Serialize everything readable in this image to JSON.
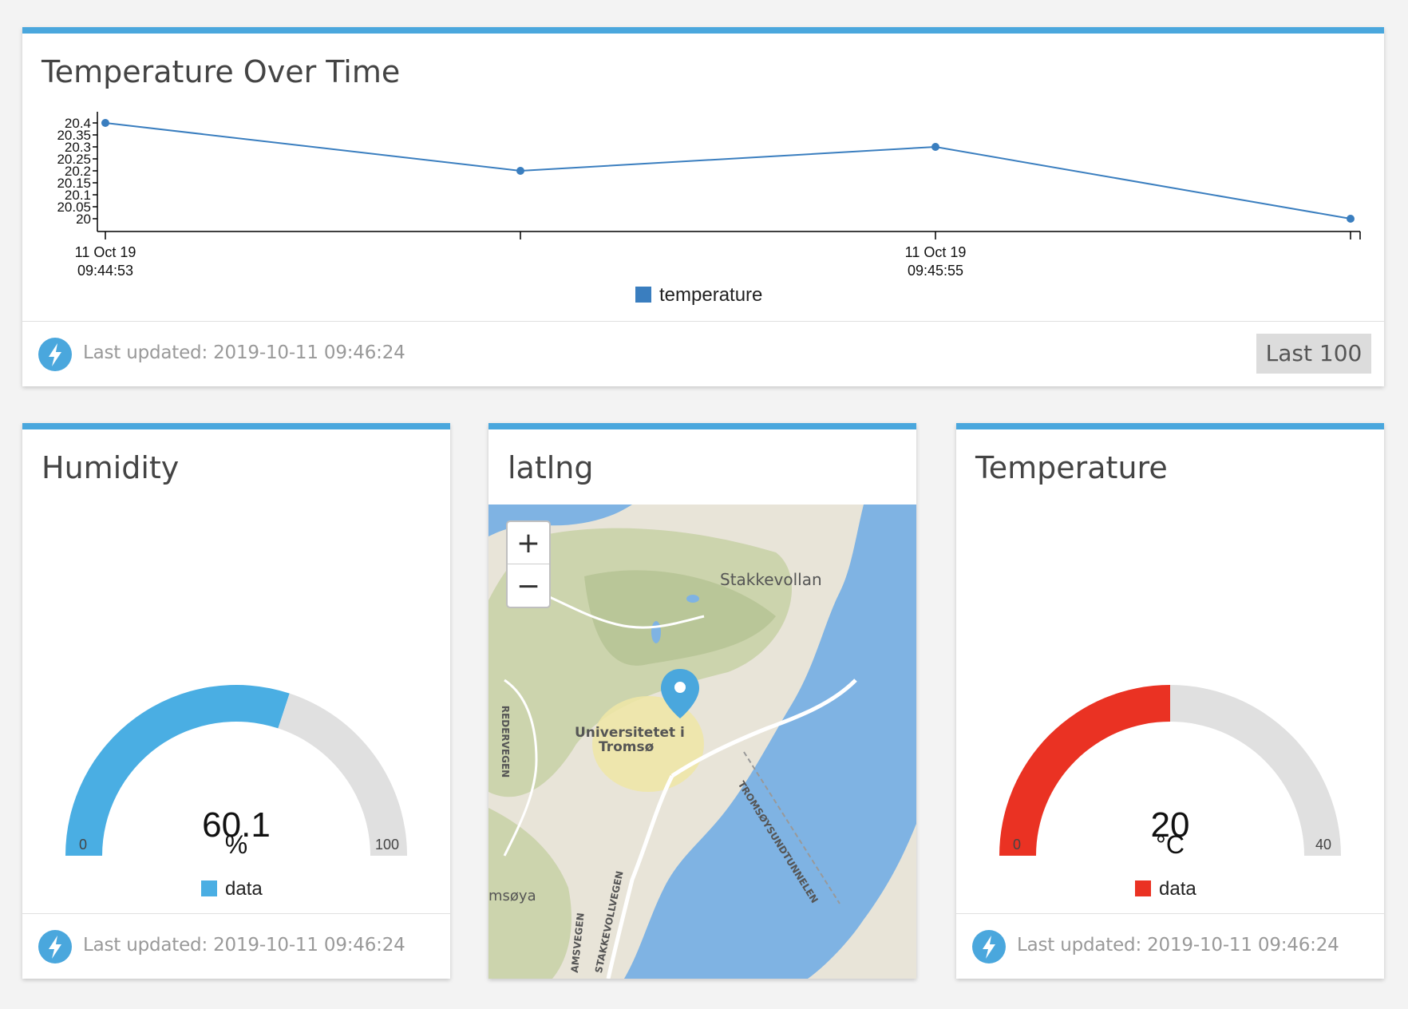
{
  "temperature_chart_card": {
    "title": "Temperature Over Time",
    "footer": {
      "updated": "Last updated: 2019-10-11 09:46:24",
      "last_button": "Last 100"
    },
    "accent_color": "#4aa7dd"
  },
  "chart_data": {
    "type": "line",
    "title": "",
    "xlabel": "",
    "ylabel": "",
    "series": [
      {
        "name": "temperature",
        "color": "#3a7ebf",
        "x": [
          "09:44:53",
          "09:45:24",
          "09:45:55",
          "09:46:24"
        ],
        "values": [
          20.4,
          20.2,
          20.3,
          20.0
        ]
      }
    ],
    "x_tick_labels": [
      {
        "date": "11 Oct 19",
        "time": "09:44:53"
      },
      {
        "date": "",
        "time": ""
      },
      {
        "date": "11 Oct 19",
        "time": "09:45:55"
      },
      {
        "date": "",
        "time": ""
      }
    ],
    "y_ticks": [
      "20",
      "20.05",
      "20.1",
      "20.15",
      "20.2",
      "20.25",
      "20.3",
      "20.35",
      "20.4"
    ],
    "ylim": [
      20,
      20.4
    ],
    "legend": "bottom-center"
  },
  "humidity_card": {
    "title": "Humidity",
    "value": "60.1",
    "unit": "%",
    "min": "0",
    "max": "100",
    "fraction": 0.601,
    "legend": "data",
    "color": "#4aaee3",
    "footer": {
      "updated": "Last updated: 2019-10-11 09:46:24"
    }
  },
  "map_card": {
    "title": "latlng",
    "zoom_in": "+",
    "zoom_out": "−",
    "labels": {
      "stakkevollan": "Stakkevollan",
      "uni_line1": "Universitetet i",
      "uni_line2": "Tromsø",
      "redervegen": "REDERVEGEN",
      "tromsoysund": "TROMSØYSUNDTUNNELEN",
      "tromsoya": "msøya",
      "stakkevollvegen": "STAKKEVOLLVEGEN",
      "amsvegen": "AMSVEGEN"
    },
    "water_color": "#7fb3e3",
    "marker_color": "#4aa7dd"
  },
  "temperature_gauge_card": {
    "title": "Temperature",
    "value": "20",
    "unit": "°C",
    "min": "0",
    "max": "40",
    "fraction": 0.5,
    "legend": "data",
    "color": "#ea3223",
    "footer": {
      "updated": "Last updated: 2019-10-11 09:46:24"
    }
  }
}
